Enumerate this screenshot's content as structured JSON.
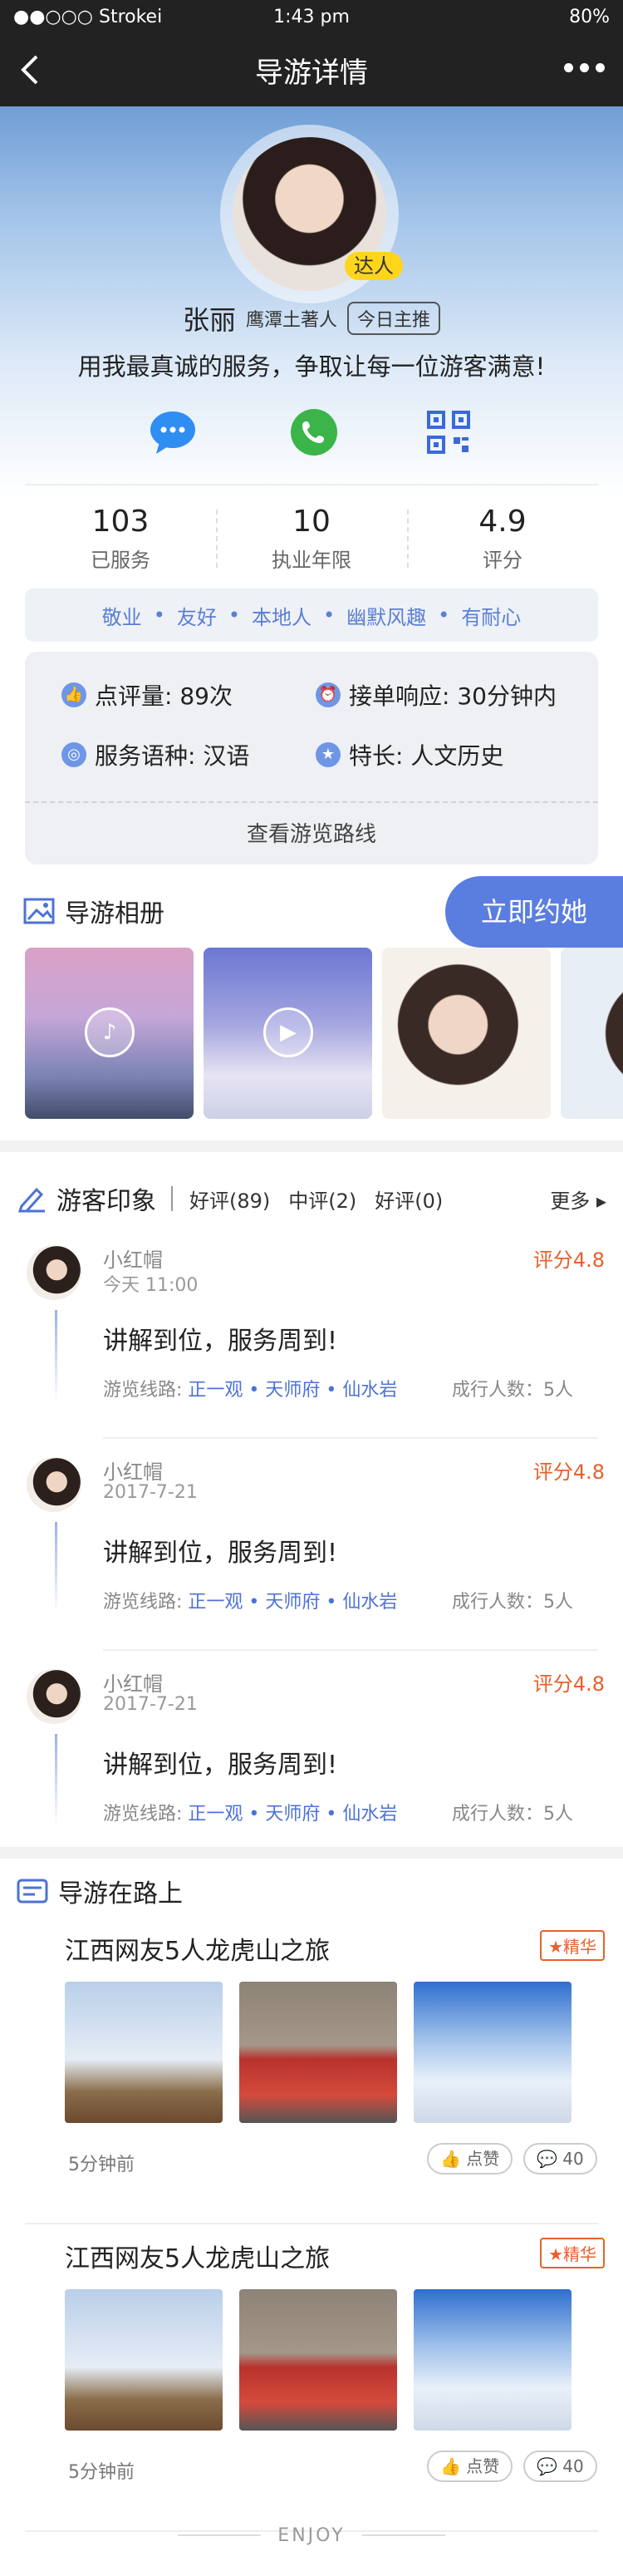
{
  "status_bar": {
    "carrier": "●●○○○ Strokei",
    "time": "1:43 pm",
    "battery": "80%"
  },
  "nav": {
    "title": "导游详情"
  },
  "profile": {
    "badge": "达人",
    "name": "张丽",
    "subtitle": "鹰潭土著人",
    "tag": "今日主推",
    "motto": "用我最真诚的服务，争取让每一位游客满意!"
  },
  "stats": [
    {
      "value": "103",
      "label": "已服务"
    },
    {
      "value": "10",
      "label": "执业年限"
    },
    {
      "value": "4.9",
      "label": "评分"
    }
  ],
  "traits": [
    "敬业",
    "友好",
    "本地人",
    "幽默风趣",
    "有耐心"
  ],
  "trait_sep": "•",
  "info": {
    "reviews": "点评量: 89次",
    "response": "接单响应: 30分钟内",
    "language": "服务语种: 汉语",
    "specialty": "特长: 人文历史",
    "route_button": "查看游览路线"
  },
  "album": {
    "title": "导游相册",
    "book_button": "立即约她"
  },
  "reviews_section": {
    "title": "游客印象",
    "filters": [
      "好评(89)",
      "中评(2)",
      "好评(0)"
    ],
    "more": "更多",
    "items": [
      {
        "name": "小红帽",
        "date": "今天 11:00",
        "score": "评分4.8",
        "text": "讲解到位，服务周到!",
        "route_label": "游览线路:",
        "route": "正一观 • 天师府 • 仙水岩",
        "count": "成行人数：5人"
      },
      {
        "name": "小红帽",
        "date": "2017-7-21",
        "score": "评分4.8",
        "text": "讲解到位，服务周到!",
        "route_label": "游览线路:",
        "route": "正一观 • 天师府 • 仙水岩",
        "count": "成行人数：5人"
      },
      {
        "name": "小红帽",
        "date": "2017-7-21",
        "score": "评分4.8",
        "text": "讲解到位，服务周到!",
        "route_label": "游览线路:",
        "route": "正一观 • 天师府 • 仙水岩",
        "count": "成行人数：5人"
      }
    ]
  },
  "on_road": {
    "title": "导游在路上",
    "posts": [
      {
        "title": "江西网友5人龙虎山之旅",
        "badge": "精华",
        "time": "5分钟前",
        "like": "点赞",
        "comments": "40"
      },
      {
        "title": "江西网友5人龙虎山之旅",
        "badge": "精华",
        "time": "5分钟前",
        "like": "点赞",
        "comments": "40"
      }
    ]
  },
  "footer": {
    "text": "ENJOY"
  },
  "colors": {
    "accent": "#5a7de0",
    "score": "#e8602b",
    "badge": "#ffd51c"
  }
}
